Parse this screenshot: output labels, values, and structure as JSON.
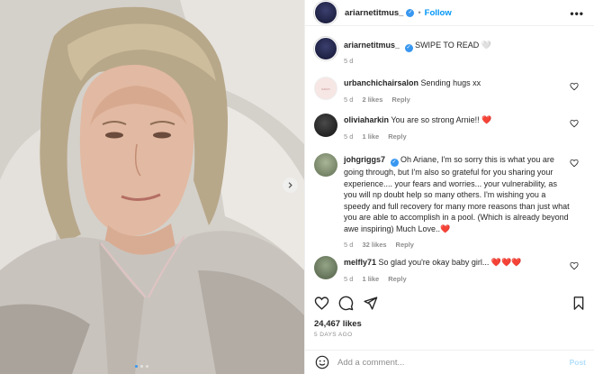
{
  "header": {
    "username": "ariarnetitmus_",
    "separator": "•",
    "follow_label": "Follow",
    "more_label": "•••"
  },
  "caption": {
    "username": "ariarnetitmus_",
    "text": "SWIPE TO READ 🤍",
    "age": "5 d"
  },
  "comments": [
    {
      "username": "urbanchichairsalon",
      "text": "Sending hugs xx",
      "age": "5 d",
      "likes": "2 likes",
      "reply_label": "Reply",
      "avatar_color": "#f6e7e5"
    },
    {
      "username": "oliviaharkin",
      "text": "You are so strong Arnie!! ❤️",
      "age": "5 d",
      "likes": "1 like",
      "reply_label": "Reply",
      "avatar_color": "#1a1a1a"
    },
    {
      "username": "johgriggs7",
      "text": "Oh Ariane, I'm so sorry this is what you are going through, but I'm also so grateful for you sharing your experience.... your fears and worries... your vulnerability, as you will np doubt help so many others. I'm wishing you a speedy and full recovery for many more reasons than just what you are able to accomplish in a pool. (Which is already beyond awe inspiring) Much Love..❤️",
      "age": "5 d",
      "likes": "32 likes",
      "reply_label": "Reply",
      "avatar_color": "#7a8a6c"
    },
    {
      "username": "melfly71",
      "text": "So glad you're okay baby girl... ❤️❤️❤️",
      "age": "5 d",
      "likes": "1 like",
      "reply_label": "Reply",
      "avatar_color": "#6d7f63"
    }
  ],
  "actions": {
    "icons": [
      "heart-icon",
      "comment-icon",
      "share-icon",
      "bookmark-icon"
    ]
  },
  "likes_count": "24,467 likes",
  "post_date": "5 DAYS AGO",
  "add_comment": {
    "placeholder": "Add a comment...",
    "post_label": "Post"
  },
  "colors": {
    "accent": "#0095f6",
    "verified": "#3897f0",
    "muted": "#8e8e8e"
  }
}
